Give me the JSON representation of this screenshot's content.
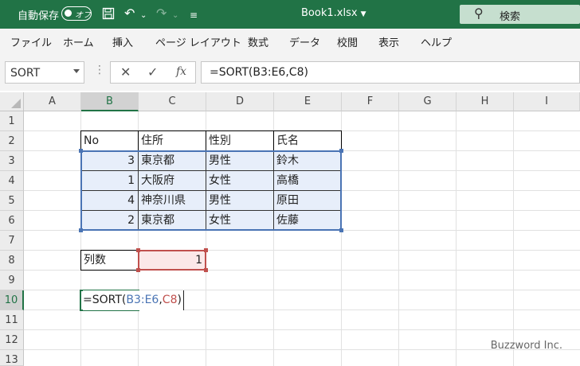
{
  "titlebar": {
    "autosave_label": "自動保存",
    "autosave_state": "オフ",
    "document_title": "Book1.xlsx",
    "search_label": "検索"
  },
  "menu": [
    "ファイル",
    "ホーム",
    "挿入",
    "ページ レイアウト",
    "数式",
    "データ",
    "校閲",
    "表示",
    "ヘルプ"
  ],
  "formula_bar": {
    "name_box": "SORT",
    "formula": "=SORT(B3:E6,C8)"
  },
  "columns": [
    "A",
    "B",
    "C",
    "D",
    "E",
    "F",
    "G",
    "H",
    "I"
  ],
  "rows": [
    "1",
    "2",
    "3",
    "4",
    "5",
    "6",
    "7",
    "8",
    "9",
    "10",
    "11",
    "12",
    "13"
  ],
  "table": {
    "headers": [
      "No",
      "住所",
      "性別",
      "氏名"
    ],
    "rows": [
      {
        "no": "3",
        "address": "東京都",
        "gender": "男性",
        "name": "鈴木"
      },
      {
        "no": "1",
        "address": "大阪府",
        "gender": "女性",
        "name": "高橋"
      },
      {
        "no": "4",
        "address": "神奈川県",
        "gender": "男性",
        "name": "原田"
      },
      {
        "no": "2",
        "address": "東京都",
        "gender": "女性",
        "name": "佐藤"
      }
    ]
  },
  "param": {
    "label": "列数",
    "value": "1"
  },
  "editing": {
    "prefix": "=SORT(",
    "ref1": "B3:E6",
    "comma": ",",
    "ref2": "C8",
    "suffix": ")"
  },
  "colors": {
    "excel_green": "#217346",
    "ref_blue": "#4a74b4",
    "ref_red": "#c0504d"
  },
  "watermark": "Buzzword Inc."
}
